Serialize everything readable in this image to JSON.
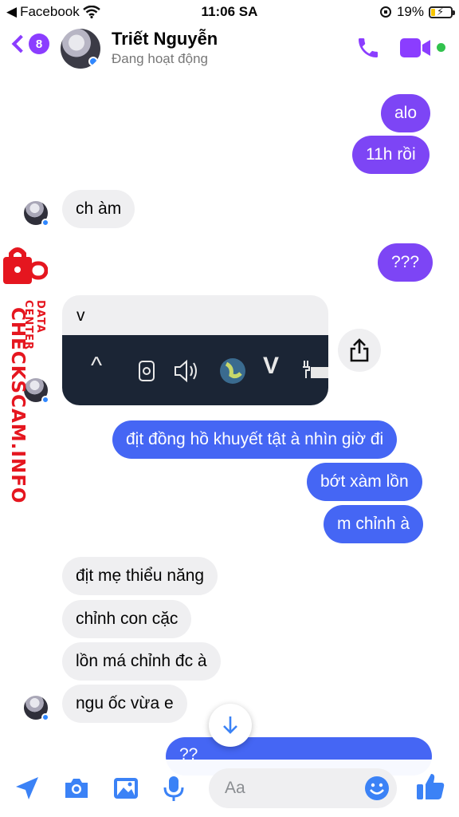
{
  "status_bar": {
    "carrier": "Facebook",
    "time": "11:06 SA",
    "battery": "19%",
    "battery_level": 0.19
  },
  "header": {
    "unread_count": "8",
    "contact_name": "Triết Nguyễn",
    "contact_status": "Đang hoạt động"
  },
  "messages": {
    "m1": "alo",
    "m2": "11h rồi",
    "m3": "ch àm",
    "m4": "???",
    "m5_caption": "v",
    "m6": "địt đồng hồ khuyết tật à nhìn giờ đi",
    "m7": "bớt xàm lồn",
    "m8": "m chỉnh à",
    "m9": "địt mẹ thiểu năng",
    "m10": "chỉnh con cặc",
    "m11": "lồn má chỉnh đc à",
    "m12": "ngu ốc vừa e",
    "m13": "??"
  },
  "taskbar_icons": [
    "^",
    "V"
  ],
  "watermark": {
    "main": "CHECKSCAM.INFO",
    "sub": "DATA CENTER"
  },
  "composer": {
    "placeholder": "Aa"
  },
  "colors": {
    "accent_purple": "#7d45f5",
    "accent_blue": "#4566f4",
    "incoming_bubble": "#efeff1",
    "online_green": "#31c24d"
  }
}
